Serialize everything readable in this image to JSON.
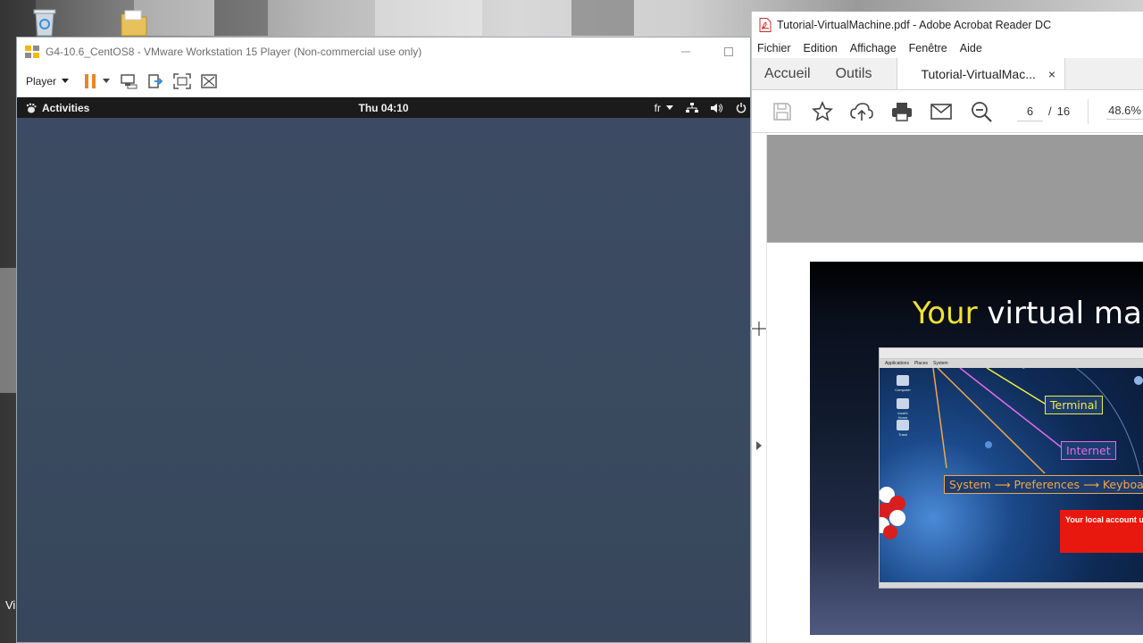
{
  "vmware": {
    "title": "G4-10.6_CentOS8 - VMware Workstation 15 Player (Non-commercial use only)",
    "player_menu": "Player",
    "guest": {
      "activities": "Activities",
      "clock": "Thu 04:10",
      "keyboard_layout": "fr"
    }
  },
  "desktop": {
    "left_text": "Vi"
  },
  "acrobat": {
    "title": "Tutorial-VirtualMachine.pdf - Adobe Acrobat Reader DC",
    "menu": [
      "Fichier",
      "Edition",
      "Affichage",
      "Fenêtre",
      "Aide"
    ],
    "tabs": {
      "home": "Accueil",
      "tools": "Outils",
      "document": "Tutorial-VirtualMac...",
      "close_symbol": "×"
    },
    "toolbar": {
      "current_page": "6",
      "page_sep": "/",
      "total_pages": "16",
      "zoom": "48.6%"
    },
    "slide": {
      "title_highlight": "Your",
      "title_rest": " virtual mac",
      "menu_items": [
        "Applications",
        "Places",
        "System"
      ],
      "desk_icons": [
        "Computer",
        "local's Home",
        "Trash"
      ],
      "label_terminal": "Terminal",
      "label_internet": "Internet",
      "label_system": "System ⟶ Preferences ⟶ Keyboard",
      "red_box_text": "Your local account u"
    }
  },
  "colors": {
    "guest_desktop": "#3a4a60",
    "gnome_topbar": "#1b1b1b",
    "pause_orange": "#e8862a",
    "label_yellow": "#f2ec40",
    "label_pink": "#e56be8",
    "label_orange": "#f3a64a",
    "red_box": "#e9180e"
  }
}
